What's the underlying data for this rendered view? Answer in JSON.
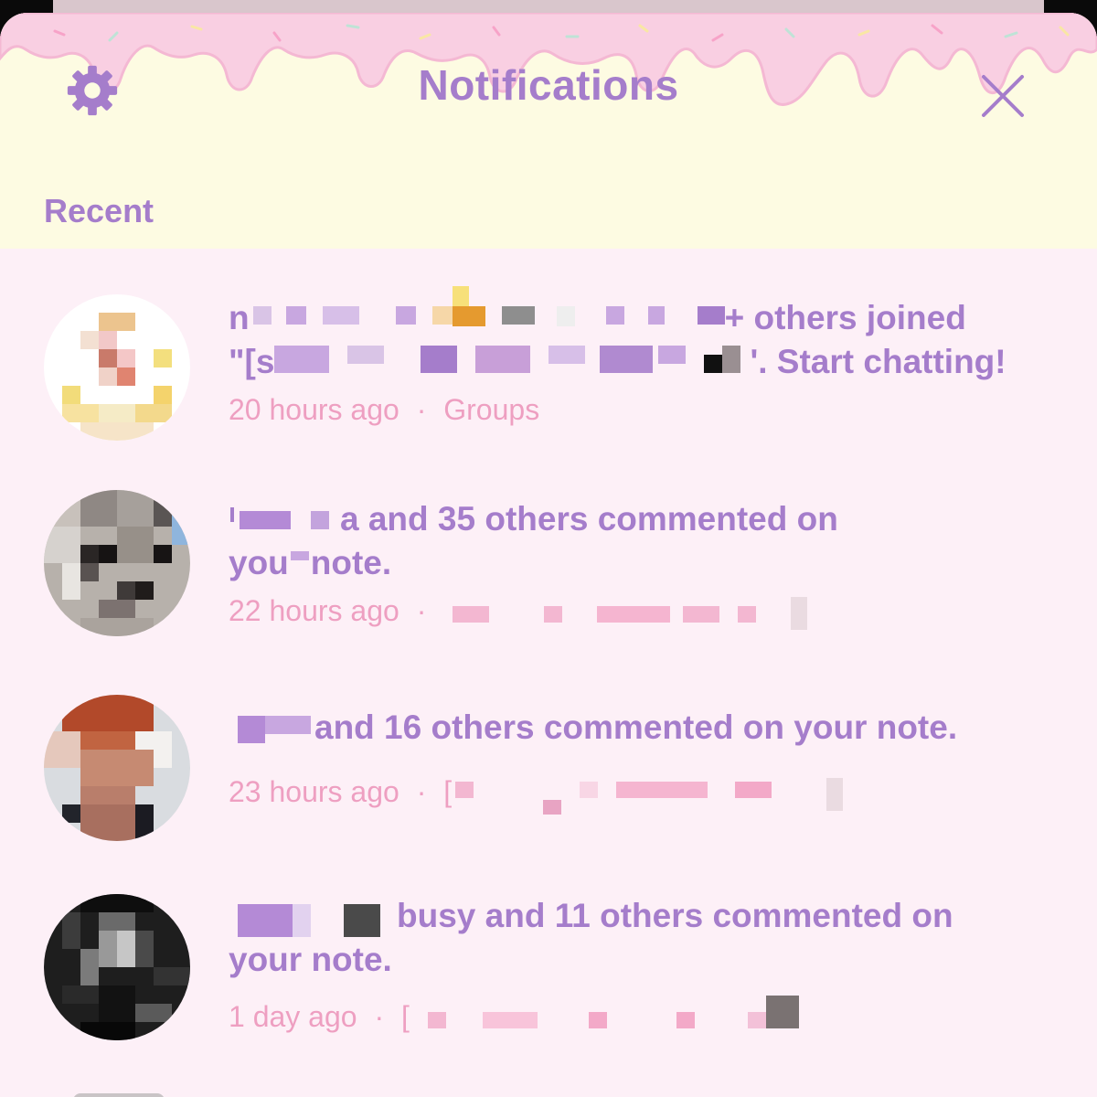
{
  "header": {
    "title": "Notifications",
    "settings_icon": "gear-icon",
    "close_icon": "close-icon",
    "section_label": "Recent"
  },
  "colors": {
    "accent": "#a57dcb",
    "meta": "#ee9fc1",
    "header_bg": "#fdfbe2",
    "list_bg": "#fdf0f7",
    "drip": "#f9cfe2"
  },
  "notifications": [
    {
      "text_prefix": "n",
      "text_mid": "+ others joined",
      "text_line2_prefix": "\"[s",
      "text_line2_suffix": "'. Start chatting!",
      "time": "20 hours ago",
      "separator": "·",
      "source": "Groups"
    },
    {
      "text_prefix": "",
      "text_mid": "a and 35 others commented on",
      "text_line2_prefix": "you",
      "text_line2_suffix": "note.",
      "time": "22 hours ago",
      "separator": "·"
    },
    {
      "text_prefix": "",
      "text_mid": "and 16 others commented on your note.",
      "time": "23 hours ago",
      "separator": "·",
      "source_prefix": "["
    },
    {
      "text_prefix": "",
      "text_mid": "busy and 11 others commented on",
      "text_line2_prefix": "your note.",
      "time": "1 day ago",
      "separator": "·",
      "source_prefix": "["
    }
  ]
}
